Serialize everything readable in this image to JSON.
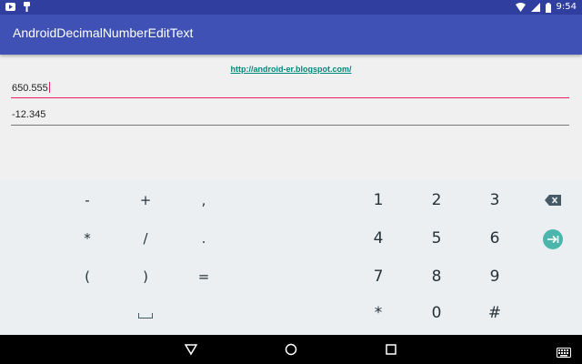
{
  "status": {
    "time": "9:54"
  },
  "app": {
    "title": "AndroidDecimalNumberEditText"
  },
  "link": "http://android-er.blogspot.com/",
  "fields": [
    {
      "value": "650.555"
    },
    {
      "value": "-12.345"
    }
  ],
  "keyboard": {
    "symbols": [
      "-",
      "+",
      ",",
      "*",
      "/",
      ".",
      "(",
      ")",
      "="
    ],
    "digits": [
      "1",
      "2",
      "3",
      "4",
      "5",
      "6",
      "7",
      "8",
      "9",
      "*",
      "0",
      "#"
    ]
  },
  "colors": {
    "primary": "#3f51b5",
    "primary_dark": "#303f9f",
    "accent": "#e91e63",
    "action_key": "#4db6ac",
    "link": "#00897b"
  },
  "icons": {
    "status_left": [
      "youtube-icon",
      "notification-icon"
    ],
    "status_right": [
      "wifi-icon",
      "signal-icon",
      "battery-icon"
    ],
    "keyboard": [
      "backspace-icon",
      "tab-next-icon",
      "space-bar-icon"
    ],
    "navbar": [
      "back-icon",
      "home-icon",
      "recents-icon",
      "keyboard-icon"
    ]
  }
}
